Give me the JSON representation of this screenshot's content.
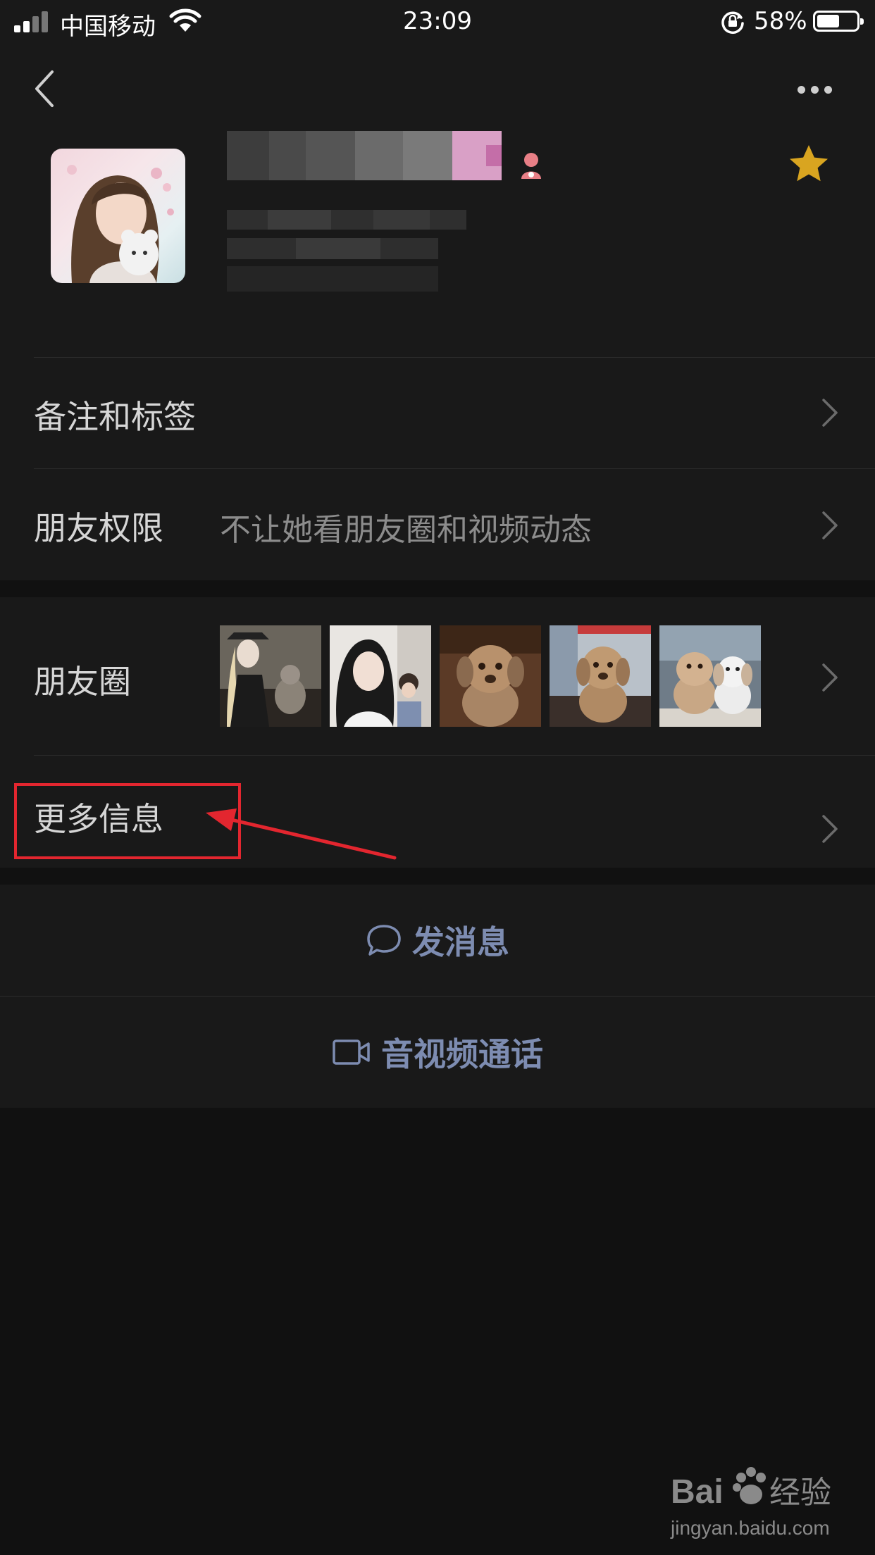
{
  "status_bar": {
    "carrier": "中国移动",
    "time": "23:09",
    "battery_percent": "58%",
    "battery_level": 0.58
  },
  "nav": {
    "back_icon": "chevron-left-icon",
    "more_icon": "more-horizontal-icon"
  },
  "profile": {
    "gender_icon": "female-icon",
    "star_icon": "star-icon",
    "star_color": "#d9a520"
  },
  "rows": {
    "remark_label": "备注和标签",
    "permission_label": "朋友权限",
    "permission_value": "不让她看朋友圈和视频动态",
    "moments_label": "朋友圈",
    "more_info_label": "更多信息"
  },
  "actions": {
    "message_label": "发消息",
    "message_icon": "chat-bubble-icon",
    "call_label": "音视频通话",
    "call_icon": "video-camera-icon"
  },
  "colors": {
    "background": "#111111",
    "panel": "#191919",
    "action_text": "#7d8cb1",
    "highlight": "#e3262f"
  },
  "watermark": {
    "brand": "Bai经验",
    "url": "jingyan.baidu.com"
  }
}
